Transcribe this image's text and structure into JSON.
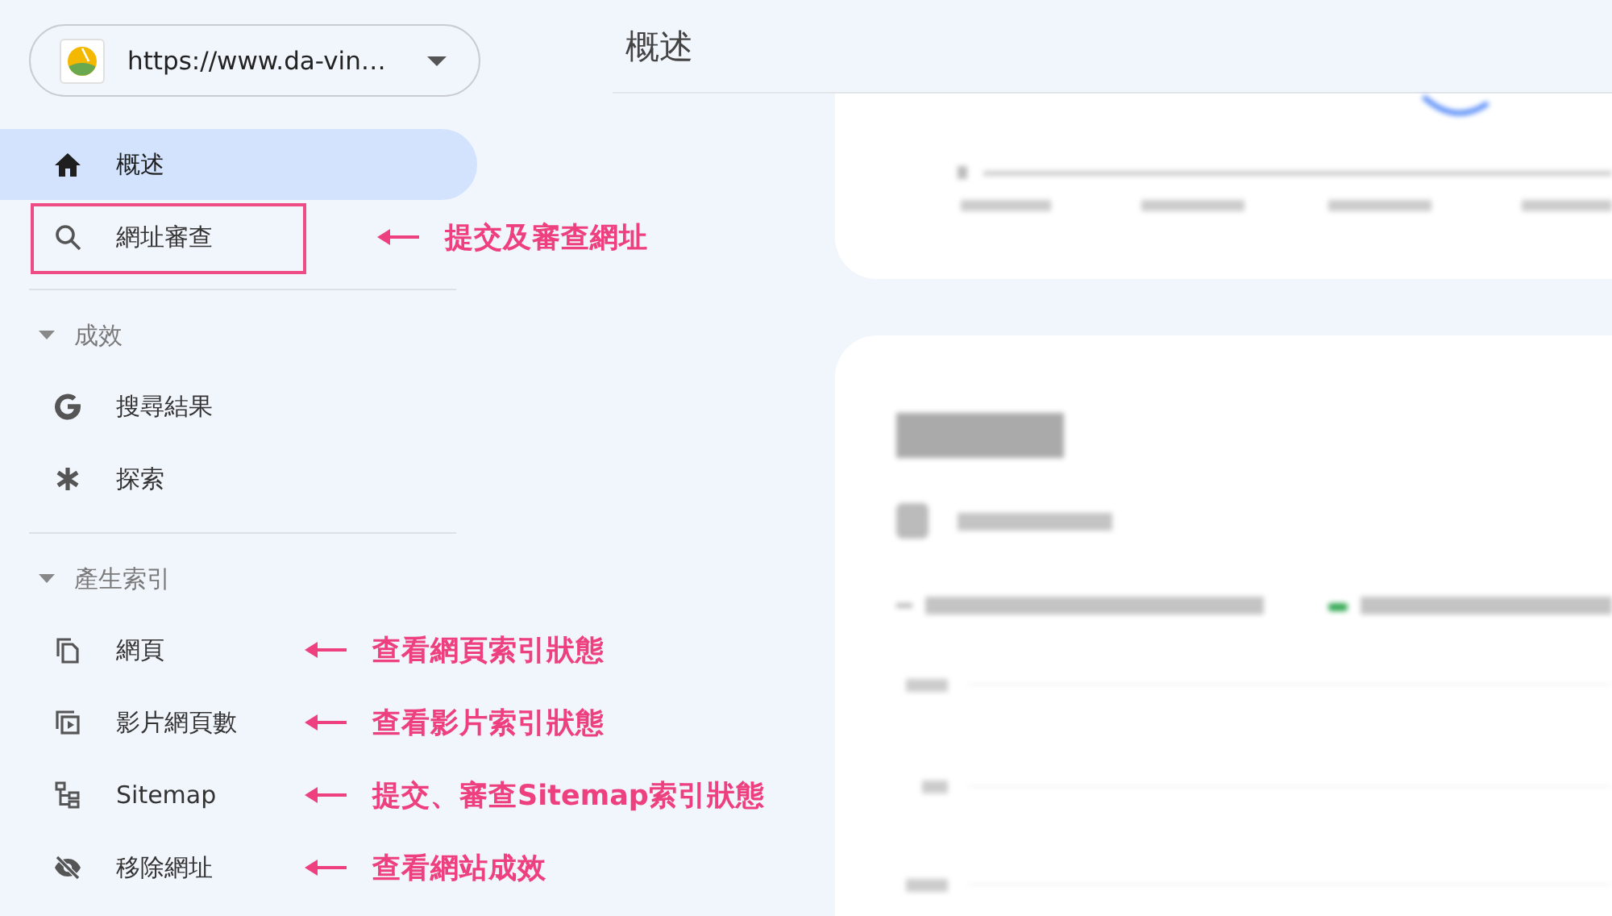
{
  "property_selector": {
    "value": "https://www.da-vin…"
  },
  "page_title": "概述",
  "sidebar": {
    "top_items": [
      {
        "label": "概述",
        "selected": true
      },
      {
        "label": "網址審查",
        "selected": false,
        "callout": "提交及審查網址",
        "boxed": true
      }
    ],
    "sections": [
      {
        "title": "成效",
        "expanded": true,
        "items": [
          {
            "label": "搜尋結果",
            "selected": false
          },
          {
            "label": "探索",
            "selected": false
          }
        ]
      },
      {
        "title": "產生索引",
        "expanded": true,
        "items": [
          {
            "label": "網頁",
            "selected": false,
            "callout": "查看網頁索引狀態"
          },
          {
            "label": "影片網頁數",
            "selected": false,
            "callout": "查看影片索引狀態"
          },
          {
            "label": "Sitemap",
            "selected": false,
            "callout": "提交、審查Sitemap索引狀態"
          },
          {
            "label": "移除網址",
            "selected": false,
            "callout": "查看網站成效"
          }
        ]
      }
    ]
  }
}
